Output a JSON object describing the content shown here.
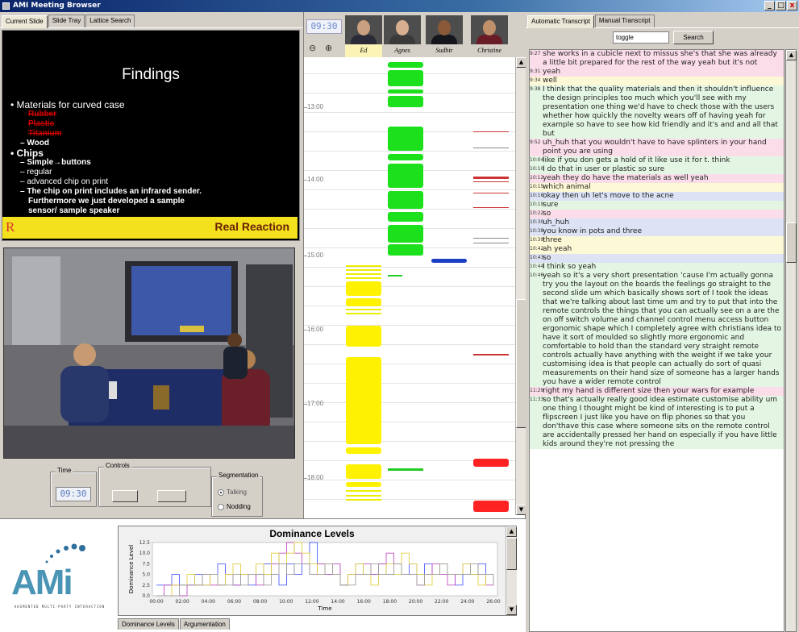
{
  "window": {
    "title": "AMI Meeting Browser",
    "minimize": "_",
    "restore": "□",
    "close": "x"
  },
  "left": {
    "tabs": [
      "Current Slide",
      "Slide Tray",
      "Lattice Search"
    ],
    "slide": {
      "title": "Findings",
      "heading1": "Materials for curved case",
      "struck": [
        "Rubber",
        "Plastic",
        "Titanium"
      ],
      "wood": "– Wood",
      "heading2": "Chips",
      "items": [
        "– Simple→buttons",
        "– regular",
        "– advanced chip on print",
        "– The chip on print includes an infrared sender."
      ],
      "cont1": "Furthermore we just developed a sample",
      "cont2": "sensor/ sample speaker",
      "footer": "Real Reaction",
      "footer_logo": "R"
    },
    "time_label": "Time",
    "time_value": "09:30",
    "controls_label": "Controls",
    "segmentation_label": "Segmentation",
    "seg_options": [
      "Talking",
      "Nodding"
    ]
  },
  "timeline": {
    "clock": "09:30",
    "participants": [
      "Ed",
      "Agnes",
      "Sudhir",
      "Christine"
    ],
    "zoom_out": "🔍",
    "zoom_in": "🔍",
    "times": [
      "13:00",
      "14:00",
      "15:00",
      "16:00",
      "17:00",
      "18:00"
    ]
  },
  "transcript": {
    "tabs": [
      "Automatic Transcript",
      "Manual Transcript"
    ],
    "search_value": "toggle",
    "search_button": "Search",
    "rows": [
      {
        "t": "9:27",
        "bg": "pink",
        "text": "she works in a cubicle next to missus she's that she was already a little bit prepared for the rest of the way yeah but it's not"
      },
      {
        "t": "9:31",
        "bg": "pink",
        "text": "yeah"
      },
      {
        "t": "9:34",
        "bg": "yellow",
        "text": "well"
      },
      {
        "t": "9:38",
        "bg": "green",
        "text": "I think that the quality materials and then it shouldn't influence the design principles too much which you'll see with my presentation one thing we'd have to check those with the users whether how quickly the novelty wears off of having yeah for example so have to see how kid friendly and it's and and all that but"
      },
      {
        "t": "9:52",
        "bg": "pink",
        "text": "uh_huh that you wouldn't have to have splinters in your hand point you are using"
      },
      {
        "t": "10:04",
        "bg": "green",
        "text": "like if you don gets a hold of it like use it for t. think"
      },
      {
        "t": "10:10",
        "bg": "green",
        "text": "I do that in user or plastic so sure"
      },
      {
        "t": "10:12",
        "bg": "pink",
        "text": "yeah they do have the materials as well yeah"
      },
      {
        "t": "10:15",
        "bg": "yellow",
        "text": "which animal"
      },
      {
        "t": "10:16",
        "bg": "blue",
        "text": "okay then uh let's move to the acne"
      },
      {
        "t": "10:19",
        "bg": "green",
        "text": "sure"
      },
      {
        "t": "10:22",
        "bg": "pink",
        "text": "so"
      },
      {
        "t": "10:30",
        "bg": "blue",
        "text": "uh_huh"
      },
      {
        "t": "10:38",
        "bg": "blue",
        "text": "you know in pots and three"
      },
      {
        "t": "10:39",
        "bg": "yellow",
        "text": "three"
      },
      {
        "t": "10:42",
        "bg": "yellow",
        "text": "ah yeah"
      },
      {
        "t": "10:43",
        "bg": "blue",
        "text": "so"
      },
      {
        "t": "10:44",
        "bg": "green",
        "text": "I think so yeah"
      },
      {
        "t": "10:46",
        "bg": "green",
        "text": "yeah so it's a very short presentation 'cause I'm actually gonna try you the layout on the boards the feelings go straight to the second slide um which basically shows sort of I took the ideas that we're talking about last time um and try to put that into the remote controls the things that you can actually see on a are the on off switch volume and channel control menu access button ergonomic shape which I completely agree with christians idea to have it sort of moulded so slightly more ergonomic and comfortable to hold than the standard very straight remote controls actually have anything with the weight if we take your customising idea is that people can actually do sort of quasi measurements on their hand size of someone has a larger hands you have a wider remote control"
      },
      {
        "t": "11:29",
        "bg": "pink",
        "text": "right my hand is different size then your wars for example"
      },
      {
        "t": "11:33",
        "bg": "green",
        "text": "so that's actually really good idea estimate customise ability um one thing I thought might be kind of interesting is to put a flipscreen I just like you have on flip phones so that you don'thave this case where someone sits on the remote control are accidentally pressed her hand on especially if you have little kids around they're not pressing the"
      }
    ]
  },
  "bottom": {
    "logo": "AMi",
    "logo_sub": "AUGMENTED MULTI-PARTY INTERACTION",
    "tabs": [
      "Dominance Levels",
      "Argumentation"
    ]
  },
  "chart_data": {
    "type": "line",
    "title": "Dominance Levels",
    "xlabel": "Time",
    "ylabel": "Dominance Level",
    "x_ticks": [
      "00:00",
      "02:00",
      "04:00",
      "06:00",
      "08:00",
      "10:00",
      "12:00",
      "14:00",
      "16:00",
      "18:00",
      "20:00",
      "22:00",
      "24:00",
      "26:00"
    ],
    "y_ticks": [
      "0.0",
      "2.5",
      "5.0",
      "7.5",
      "10.0",
      "12.5"
    ],
    "ylim": [
      0,
      12.5
    ],
    "xlim": [
      0,
      26
    ],
    "series": [
      {
        "color": "#5060ff",
        "values": [
          2.5,
          2.5,
          5,
          2.5,
          2.5,
          5,
          2.5,
          5,
          7.5,
          5,
          2.5,
          5,
          2.5,
          5,
          7.5,
          5,
          2.5,
          7.5,
          5,
          7.5,
          12.5,
          7.5,
          5,
          5,
          2.5,
          5,
          7.5,
          5,
          5,
          7.5,
          5,
          7.5,
          5,
          7.5,
          5,
          7.5,
          5,
          7.5,
          5,
          2.5,
          5,
          5,
          7.5,
          5,
          2.5
        ]
      },
      {
        "color": "#c050c0",
        "values": [
          0,
          2.5,
          2.5,
          0,
          2.5,
          2.5,
          5,
          2.5,
          2.5,
          5,
          2.5,
          5,
          5,
          2.5,
          5,
          7.5,
          10,
          12.5,
          10,
          7.5,
          5,
          7.5,
          5,
          7.5,
          2.5,
          5,
          5,
          7.5,
          5,
          7.5,
          10,
          7.5,
          5,
          5,
          2.5,
          5,
          7.5,
          5,
          2.5,
          5,
          7.5,
          5,
          5,
          2.5,
          5
        ]
      },
      {
        "color": "#e0d040",
        "values": [
          0,
          0,
          2.5,
          2.5,
          5,
          2.5,
          2.5,
          5,
          2.5,
          5,
          7.5,
          5,
          5,
          7.5,
          5,
          10,
          7.5,
          10,
          12.5,
          10,
          7.5,
          5,
          7.5,
          5,
          2.5,
          5,
          7.5,
          5,
          2.5,
          5,
          7.5,
          5,
          10,
          7.5,
          5,
          2.5,
          5,
          7.5,
          5,
          5,
          7.5,
          5,
          2.5,
          5,
          5
        ]
      },
      {
        "color": "#a0a0a0",
        "values": [
          0,
          0,
          0,
          2.5,
          2.5,
          2.5,
          5,
          5,
          2.5,
          2.5,
          5,
          2.5,
          5,
          5,
          2.5,
          5,
          7.5,
          5,
          7.5,
          7.5,
          5,
          5,
          7.5,
          5,
          2.5,
          2.5,
          5,
          5,
          7.5,
          5,
          5,
          7.5,
          5,
          5,
          2.5,
          5,
          5,
          7.5,
          5,
          5,
          5,
          7.5,
          5,
          5,
          2.5
        ]
      }
    ]
  }
}
